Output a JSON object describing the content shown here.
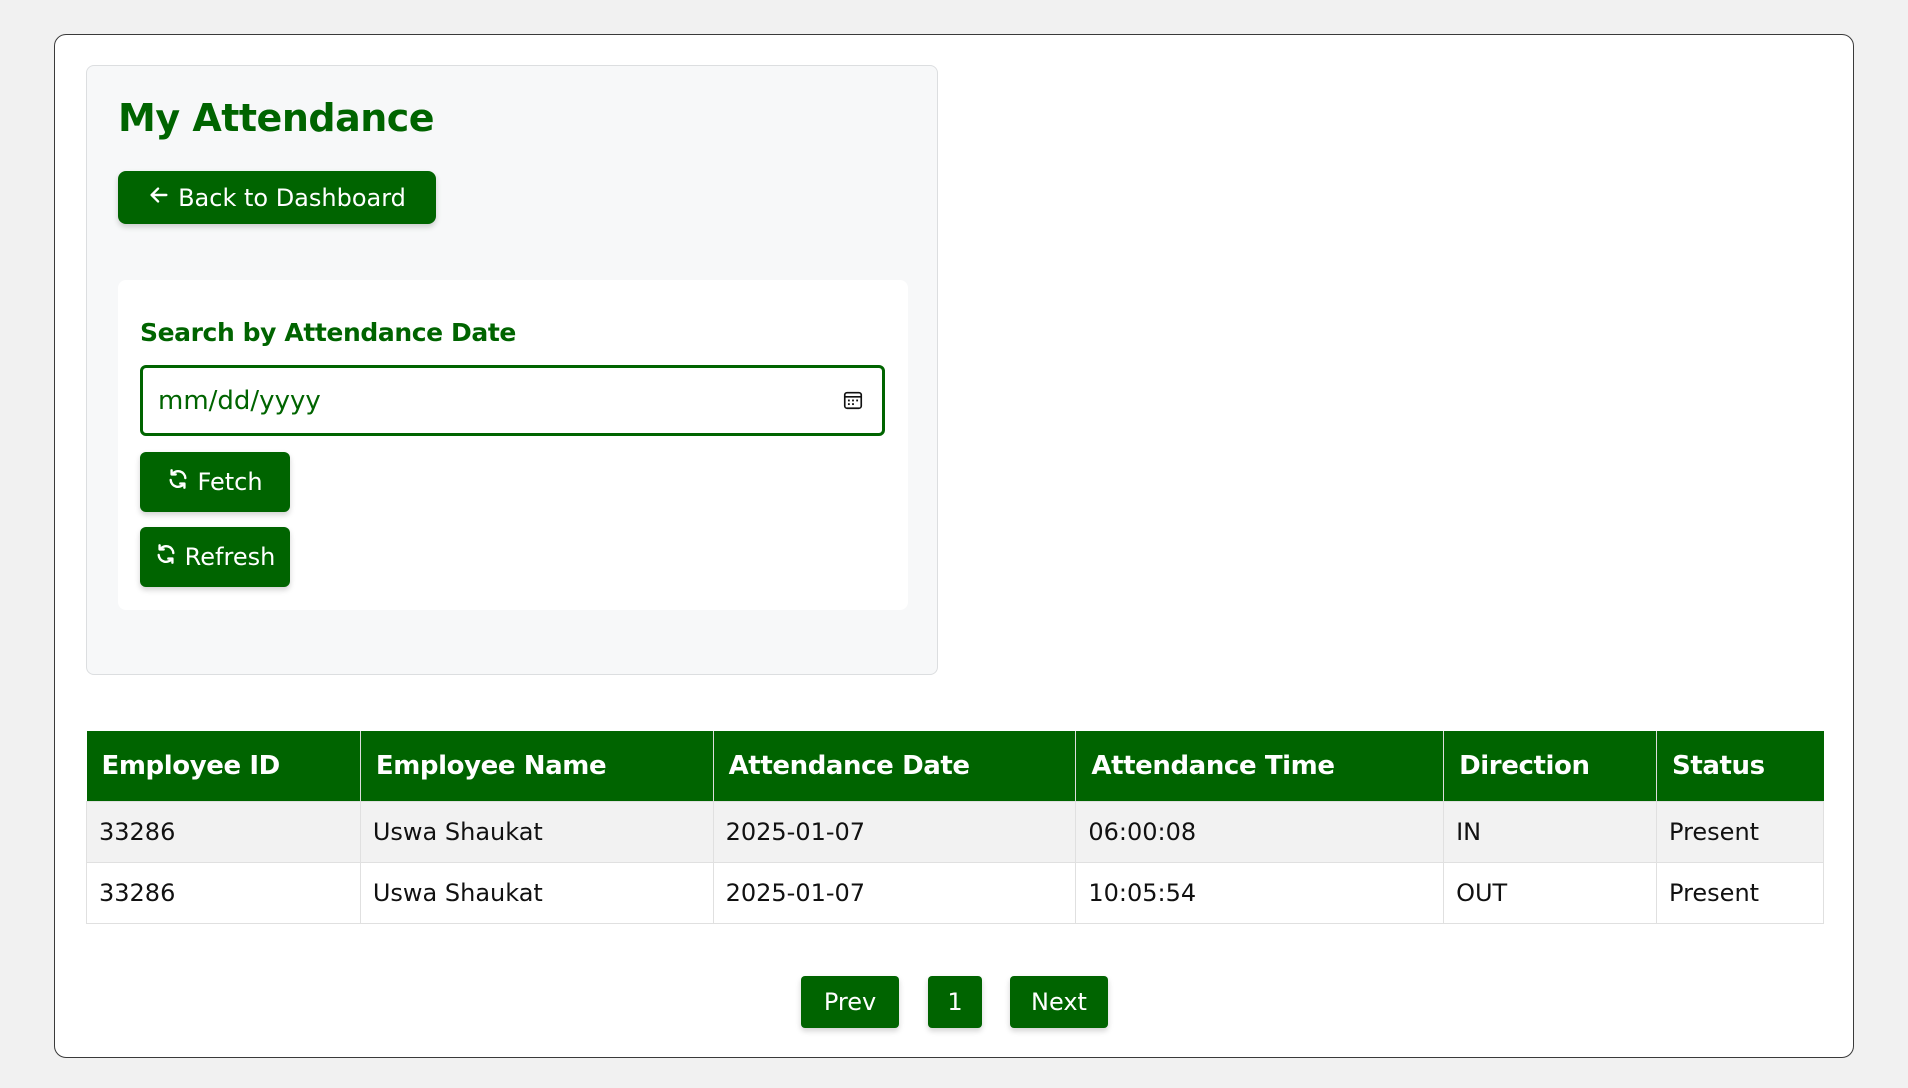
{
  "page": {
    "title": "My Attendance",
    "back_button": "Back to Dashboard"
  },
  "search": {
    "label": "Search by Attendance Date",
    "date_placeholder": "mm/dd/yyyy",
    "fetch_label": "Fetch",
    "refresh_label": "Refresh"
  },
  "table": {
    "headers": [
      "Employee ID",
      "Employee Name",
      "Attendance Date",
      "Attendance Time",
      "Direction",
      "Status"
    ],
    "rows": [
      [
        "33286",
        "Uswa Shaukat",
        "2025-01-07",
        "06:00:08",
        "IN",
        "Present"
      ],
      [
        "33286",
        "Uswa Shaukat",
        "2025-01-07",
        "10:05:54",
        "OUT",
        "Present"
      ]
    ]
  },
  "pagination": {
    "prev": "Prev",
    "current_page": "1",
    "next": "Next"
  },
  "icons": {
    "back": "arrow-left-icon",
    "calendar": "calendar-icon",
    "fetch": "refresh-icon",
    "refresh": "refresh-icon"
  },
  "colors": {
    "primary": "#006400",
    "background": "#f1f1f1",
    "panel": "#f7f8f9"
  }
}
